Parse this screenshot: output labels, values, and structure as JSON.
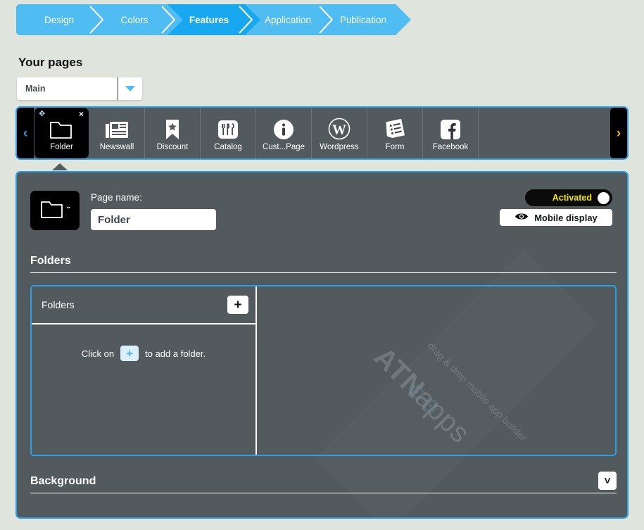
{
  "wizard": {
    "steps": [
      {
        "label": "Design",
        "active": false
      },
      {
        "label": "Colors",
        "active": false
      },
      {
        "label": "Features",
        "active": true
      },
      {
        "label": "Application",
        "active": false
      },
      {
        "label": "Publication",
        "active": false
      }
    ],
    "active_color": "#18a8f0",
    "inactive_color": "#4fbcf2"
  },
  "pages": {
    "title": "Your pages",
    "selected": "Main",
    "dropdown_icon": "caret-down-icon"
  },
  "toolbar": {
    "prev_arrow": "‹",
    "next_arrow": "›",
    "tiles": [
      {
        "label": "Folder",
        "icon": "folder-icon",
        "selected": true,
        "move_handle": "✥",
        "close": "×"
      },
      {
        "label": "Newswall",
        "icon": "newspaper-icon",
        "selected": false
      },
      {
        "label": "Discount",
        "icon": "bookmark-star-icon",
        "selected": false
      },
      {
        "label": "Catalog",
        "icon": "cutlery-icon",
        "selected": false
      },
      {
        "label": "Cust...Page",
        "icon": "info-icon",
        "selected": false
      },
      {
        "label": "Wordpress",
        "icon": "wordpress-icon",
        "selected": false
      },
      {
        "label": "Form",
        "icon": "form-document-icon",
        "selected": false
      },
      {
        "label": "Facebook",
        "icon": "facebook-icon",
        "selected": false
      }
    ]
  },
  "editor": {
    "page_icon": "folder-icon",
    "page_icon_chevron": "ˇ",
    "page_name_label": "Page name:",
    "page_name_value": "Folder",
    "page_name_placeholder": "Page name",
    "activated_label": "Activated",
    "activated_color": "#f3e600",
    "mobile_display_label": "Mobile display",
    "mobile_display_icon": "eye-icon",
    "sections": {
      "folders": {
        "heading": "Folders",
        "list_title": "Folders",
        "add_button": "+",
        "hint_before": "Click on",
        "hint_plus": "+",
        "hint_after": "to add a folder."
      },
      "background": {
        "heading": "Background",
        "collapse_icon": "chevron-down-icon"
      }
    }
  },
  "watermark": {
    "brand_bold": "ATN",
    "brand_light": "apps",
    "tagline": "drag & drop mobile app builder"
  }
}
